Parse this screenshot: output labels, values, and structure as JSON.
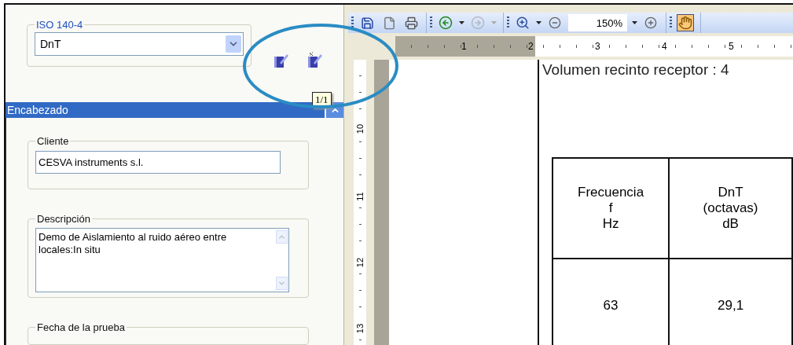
{
  "settings_panel": {
    "group_label": "ISO 140-4",
    "dropdown": {
      "value": "DnT"
    },
    "page_indicator": "1/1"
  },
  "section_header": {
    "title": "Encabezado",
    "expanded": true
  },
  "fields": [
    {
      "kind": "input",
      "label": "Cliente",
      "value": "CESVA instruments s.l."
    },
    {
      "kind": "textarea",
      "label": "Descripción",
      "value": "Demo de Aislamiento al ruido aéreo entre locales:In situ"
    },
    {
      "kind": "label_only",
      "label": "Fecha de la prueba"
    }
  ],
  "toolbar": [
    {
      "kind": "save",
      "disabled": false,
      "selected": false
    },
    {
      "kind": "page",
      "disabled": false,
      "selected": false
    },
    {
      "kind": "print",
      "disabled": false,
      "selected": false
    },
    {
      "kind": "back",
      "disabled": false,
      "selected": false
    },
    {
      "kind": "forward",
      "disabled": true,
      "selected": false
    },
    {
      "kind": "zoom_in",
      "disabled": false,
      "selected": false
    },
    {
      "kind": "zoom_out",
      "disabled": false,
      "selected": false
    },
    {
      "kind": "zoom_field",
      "value": "150%"
    },
    {
      "kind": "zoom_plus",
      "disabled": false,
      "selected": false
    },
    {
      "kind": "hand",
      "disabled": false,
      "selected": true
    }
  ],
  "ruler": {
    "horizontal": [
      "1",
      "2",
      "3",
      "4",
      "5"
    ],
    "vertical": [
      "10",
      "11",
      "12",
      "13"
    ]
  },
  "document": {
    "heading": "Volumen recinto receptor : 4",
    "table": {
      "columns": [
        "Frecuencia\nf\nHz",
        "DnT\n(octavas)\ndB"
      ],
      "rows": [
        [
          "63",
          "29,1"
        ]
      ]
    }
  }
}
